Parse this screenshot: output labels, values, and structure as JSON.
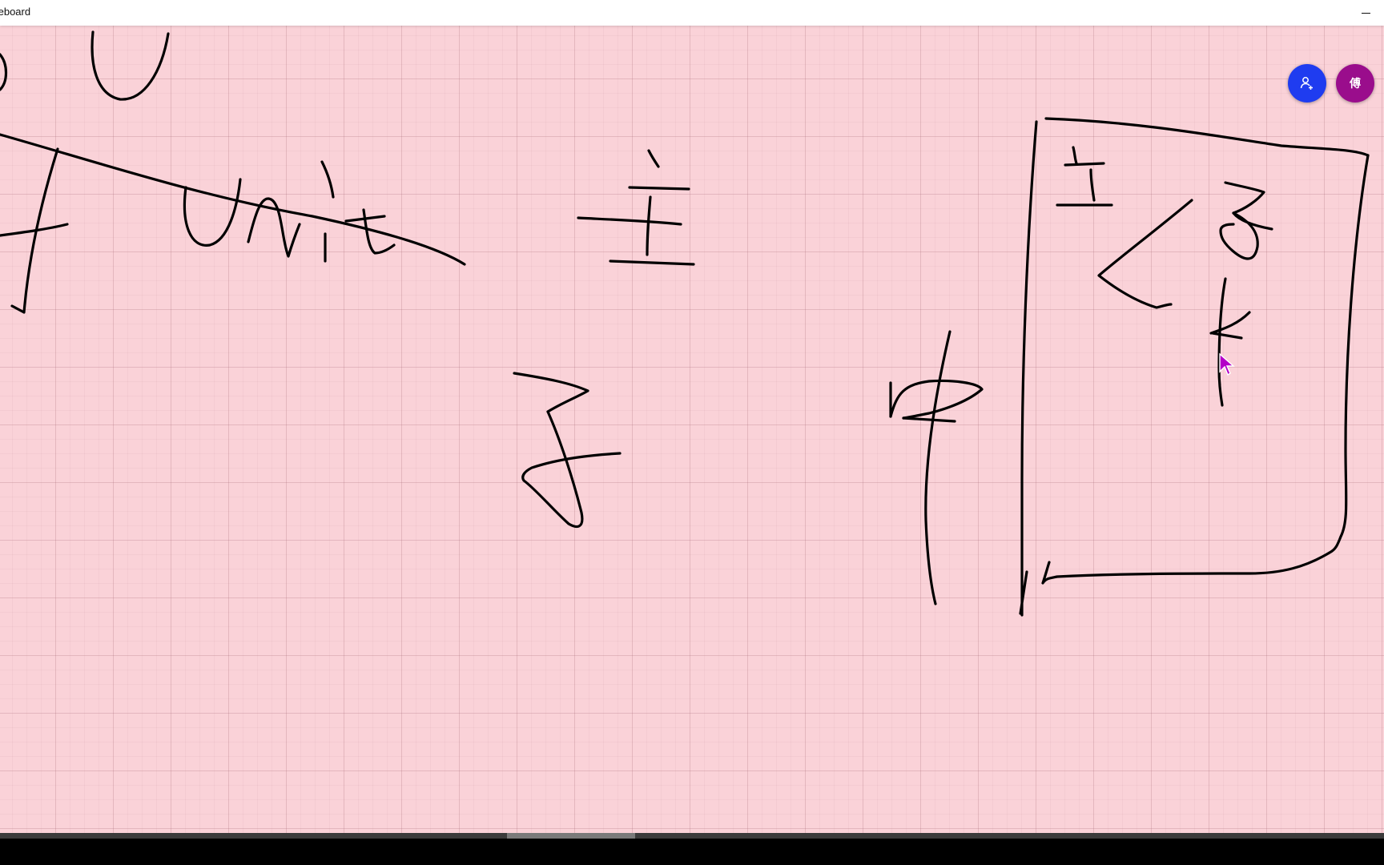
{
  "window": {
    "title": "teboard"
  },
  "collaborators": {
    "user_initial": "傅"
  },
  "canvas": {
    "background_color": "#fad2d8",
    "ink_color": "#000000",
    "cursor_color": "#b400c8"
  },
  "colors": {
    "invite_button": "#1f3cf0",
    "user_avatar": "#9a0d8c"
  },
  "icons": {
    "minimize": "minimize-icon",
    "invite": "person-add-icon",
    "cursor": "pointer-cursor-icon"
  }
}
